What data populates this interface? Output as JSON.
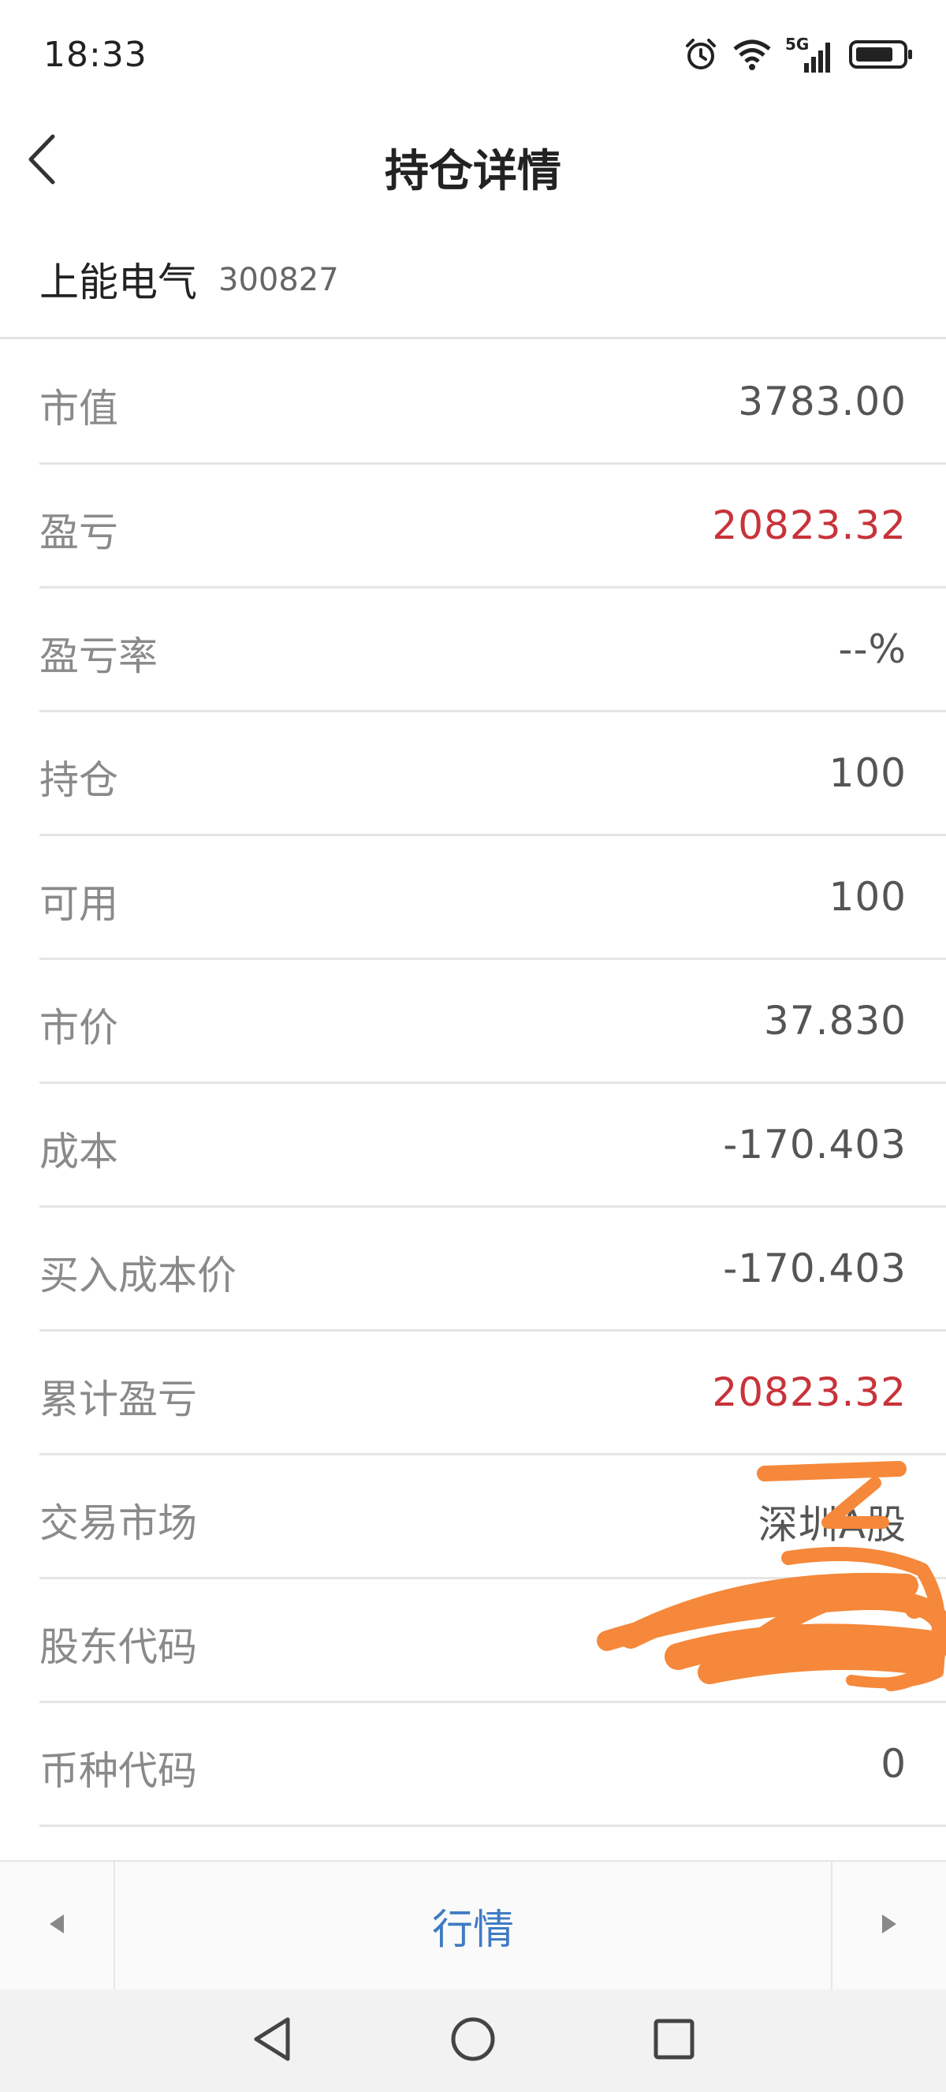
{
  "status_bar": {
    "time": "18:33",
    "icons": [
      "alarm-icon",
      "wifi-icon",
      "5g-signal-icon",
      "battery-icon"
    ],
    "network_label": "5G"
  },
  "header": {
    "title": "持仓详情",
    "back_icon": "chevron-left-icon"
  },
  "stock": {
    "name": "上能电气",
    "code": "300827"
  },
  "rows": [
    {
      "label": "市值",
      "value": "3783.00",
      "color": "#555555"
    },
    {
      "label": "盈亏",
      "value": "20823.32",
      "color": "#c8333a"
    },
    {
      "label": "盈亏率",
      "value": "--%",
      "color": "#555555"
    },
    {
      "label": "持仓",
      "value": "100",
      "color": "#555555"
    },
    {
      "label": "可用",
      "value": "100",
      "color": "#555555"
    },
    {
      "label": "市价",
      "value": "37.830",
      "color": "#555555"
    },
    {
      "label": "成本",
      "value": "-170.403",
      "color": "#555555"
    },
    {
      "label": "买入成本价",
      "value": "-170.403",
      "color": "#555555"
    },
    {
      "label": "累计盈亏",
      "value": "20823.32",
      "color": "#c8333a"
    },
    {
      "label": "交易市场",
      "value": "深圳A股",
      "color": "#555555"
    },
    {
      "label": "股东代码",
      "value": "",
      "color": "#555555"
    },
    {
      "label": "币种代码",
      "value": "0",
      "color": "#555555"
    }
  ],
  "bottom_bar": {
    "left_icon": "triangle-left-icon",
    "center_label": "行情",
    "right_icon": "triangle-right-icon"
  },
  "system_nav": {
    "icons": [
      "back-triangle-icon",
      "home-circle-icon",
      "recents-square-icon"
    ]
  },
  "colors": {
    "accent_blue": "#3f7bc4",
    "loss_profit_red": "#c8333a",
    "scribble_orange": "#f5883a"
  }
}
